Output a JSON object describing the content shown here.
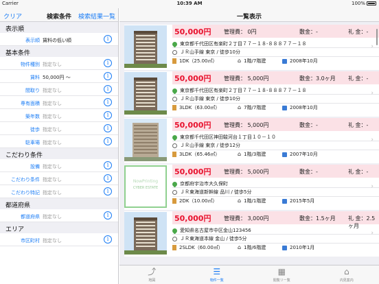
{
  "status": {
    "carrier": "Carrier",
    "time": "10:39 AM",
    "battery": "100%"
  },
  "left": {
    "clear": "クリア",
    "title": "検索条件",
    "results": "検索結果一覧",
    "sections": [
      {
        "title": "表示順",
        "rows": [
          {
            "label": "表示順",
            "value": "賃料の低い順",
            "set": true
          }
        ]
      },
      {
        "title": "基本条件",
        "rows": [
          {
            "label": "物件種別",
            "value": "指定なし"
          },
          {
            "label": "賃料",
            "value": "50,000円 〜",
            "set": true
          },
          {
            "label": "間取り",
            "value": "指定なし"
          },
          {
            "label": "専有面積",
            "value": "指定なし"
          },
          {
            "label": "築年数",
            "value": "指定なし"
          },
          {
            "label": "徒歩",
            "value": "指定なし"
          },
          {
            "label": "駐車場",
            "value": "指定なし"
          }
        ]
      },
      {
        "title": "こだわり条件",
        "rows": [
          {
            "label": "設備",
            "value": "指定なし"
          },
          {
            "label": "こだわり条件",
            "value": "指定なし"
          },
          {
            "label": "こだわり特記",
            "value": "指定なし"
          }
        ]
      },
      {
        "title": "都道府県",
        "rows": [
          {
            "label": "都道府県",
            "value": "指定なし"
          }
        ]
      },
      {
        "title": "エリア",
        "rows": [
          {
            "label": "市区町村",
            "value": "指定なし"
          }
        ]
      }
    ]
  },
  "right": {
    "title": "一覧表示",
    "items": [
      {
        "price": "50,000円",
        "kanri": "管理費： 0円",
        "shiki": "敷金：-",
        "rei": "礼 金：-",
        "address": "東京都千代田区有楽町２丁目７７－１８-８８８７７－１８",
        "station": "ＪＲ山手線 東京 / 徒歩10分",
        "layout": "1DK（25.00㎡）",
        "floor": "1階/7階建",
        "date": "2008年10月",
        "thumb": "building"
      },
      {
        "price": "50,000円",
        "kanri": "管理費： 5,000円",
        "shiki": "敷金：3.0ヶ月",
        "rei": "礼 金：-",
        "address": "東京都千代田区有楽町２丁目７７－１８-８８８７７－１８",
        "station": "ＪＲ山手線 東京 / 徒歩10分",
        "layout": "3LDK（63.00㎡）",
        "floor": "7階/7階建",
        "date": "2008年10月",
        "thumb": "building"
      },
      {
        "price": "50,000円",
        "kanri": "管理費： 5,000円",
        "shiki": "敷金：-",
        "rei": "礼 金：-",
        "address": "東京都千代田区神田駿河台１丁目１０－１０",
        "station": "ＪＲ山手線 東京 / 徒歩12分",
        "layout": "3LDK（65.46㎡）",
        "floor": "1階/3階建",
        "date": "2007年10月",
        "thumb": "tower"
      },
      {
        "price": "50,000円",
        "kanri": "管理費： 5,000円",
        "shiki": "敷金：-",
        "rei": "礼 金：-",
        "address": "京都府宇治市大久保町",
        "station": "ＪＲ東海道新幹線 品川 / 徒歩5分",
        "layout": "2DK（10.00㎡）",
        "floor": "1階/1階建",
        "date": "2015年5月",
        "thumb": "nowprinting",
        "placeholder1": "NowPrinting",
        "placeholder2": "CYBER ESTATE"
      },
      {
        "price": "50,000円",
        "kanri": "管理費： 3,000円",
        "shiki": "敷金：1.5ヶ月",
        "rei": "礼 金：2.5ヶ月",
        "address": "愛知県名古屋市中区金山123456",
        "station": "ＪＲ東海道本線 金山 / 徒歩5分",
        "layout": "2SLDK（60.00㎡）",
        "floor": "1階/6階建",
        "date": "2010年1月",
        "thumb": "building"
      }
    ]
  },
  "tabs": [
    {
      "label": "地図",
      "icon": "map-icon"
    },
    {
      "label": "物件一覧",
      "icon": "list-icon",
      "active": true
    },
    {
      "label": "閲覧リー覧",
      "icon": "grid-icon"
    },
    {
      "label": "内見案内",
      "icon": "building-icon"
    }
  ]
}
